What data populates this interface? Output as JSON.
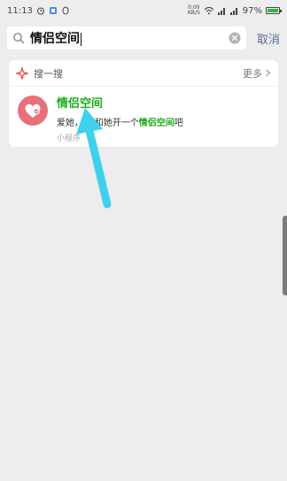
{
  "status_bar": {
    "time": "11:13",
    "net_speed_top": "0.00",
    "net_speed_bottom": "KB/S",
    "battery": "97%",
    "battery_level": 0.97
  },
  "search": {
    "query": "情侣空间",
    "cancel_label": "取消"
  },
  "section": {
    "label": "搜一搜",
    "more_label": "更多"
  },
  "result": {
    "title": "情侣空间",
    "desc_prefix": "爱她，",
    "desc_middle": "和她开一个",
    "desc_highlight": "情侣空间",
    "desc_suffix": "吧",
    "type_label": "小程序"
  },
  "colors": {
    "accent_green": "#1aad19",
    "link_blue": "#576b95",
    "logo_pink": "#e8707a",
    "arrow_cyan": "#3fd0ec"
  }
}
